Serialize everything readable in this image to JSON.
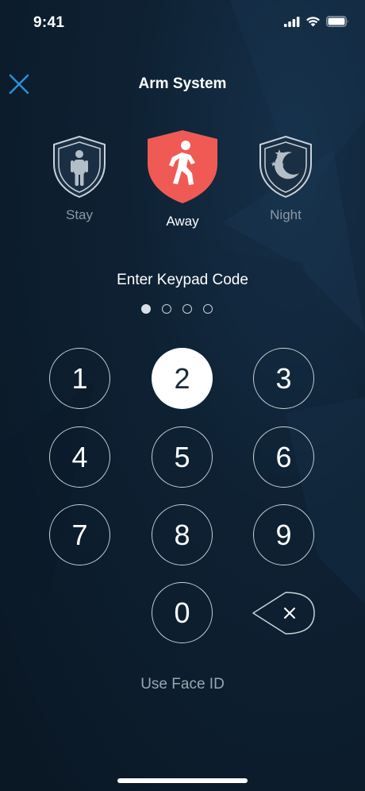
{
  "status_bar": {
    "time": "9:41",
    "icons": [
      "cellular-signal-icon",
      "wifi-icon",
      "battery-icon"
    ]
  },
  "header": {
    "close_icon": "close-icon",
    "title": "Arm System"
  },
  "modes": [
    {
      "label": "Stay",
      "icon": "person-standing-icon",
      "selected": false
    },
    {
      "label": "Away",
      "icon": "person-walking-icon",
      "selected": true
    },
    {
      "label": "Night",
      "icon": "moon-stars-icon",
      "selected": false
    }
  ],
  "keypad": {
    "prompt": "Enter Keypad Code",
    "entered_digits": 1,
    "code_length": 4,
    "keys": [
      "1",
      "2",
      "3",
      "4",
      "5",
      "6",
      "7",
      "8",
      "9",
      "0"
    ],
    "pressed_key": "2",
    "backspace_icon": "backspace-icon"
  },
  "footer": {
    "face_id_label": "Use Face ID"
  },
  "colors": {
    "accent_away": "#f05a55",
    "close_icon": "#2a8fd6",
    "background": "#0e2133"
  }
}
